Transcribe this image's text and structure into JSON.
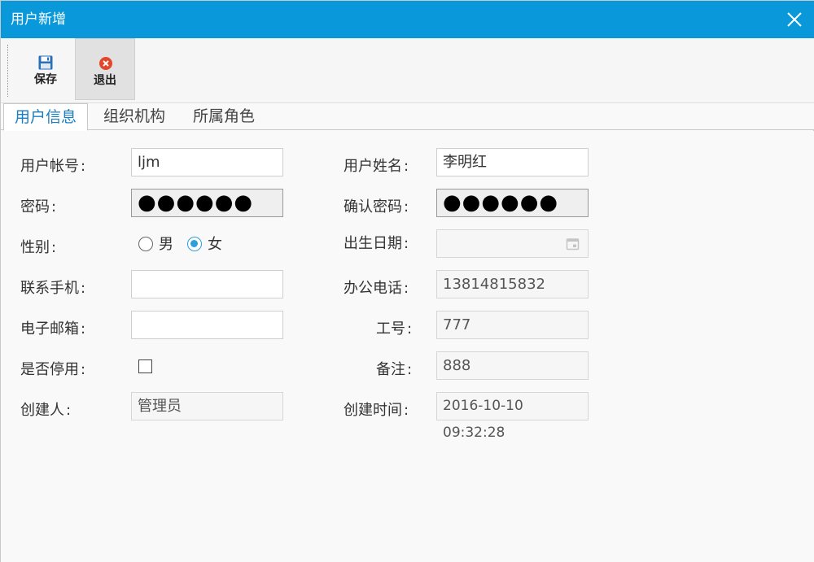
{
  "window": {
    "title": "用户新增"
  },
  "toolbar": {
    "save_label": "保存",
    "exit_label": "退出"
  },
  "tabs": [
    {
      "label": "用户信息"
    },
    {
      "label": "组织机构"
    },
    {
      "label": "所属角色"
    }
  ],
  "form": {
    "account": {
      "label": "用户帐号",
      "value": "ljm"
    },
    "name": {
      "label": "用户姓名",
      "value": "李明红"
    },
    "password": {
      "label": "密码",
      "value": "●●●●●●"
    },
    "confirm_password": {
      "label": "确认密码",
      "value": "●●●●●●"
    },
    "gender": {
      "label": "性别",
      "options": [
        "男",
        "女"
      ],
      "selected": "女"
    },
    "birthday": {
      "label": "出生日期",
      "value": ""
    },
    "mobile": {
      "label": "联系手机",
      "value": ""
    },
    "office_phone": {
      "label": "办公电话",
      "value": "13814815832"
    },
    "email": {
      "label": "电子邮箱",
      "value": ""
    },
    "employee_no": {
      "label": "工号",
      "value": "777"
    },
    "disabled": {
      "label": "是否停用",
      "checked": false
    },
    "remark": {
      "label": "备注",
      "value": "888"
    },
    "creator": {
      "label": "创建人",
      "value": "管理员"
    },
    "created_at": {
      "label": "创建时间",
      "value": "2016-10-10 09:32:28"
    },
    "colon": ":"
  },
  "colors": {
    "titlebar": "#0999db",
    "accent": "#2d9fd9",
    "active_tab_text": "#1a7fc0",
    "exit_icon": "#e4462b",
    "save_icon": "#2a6fb6"
  }
}
